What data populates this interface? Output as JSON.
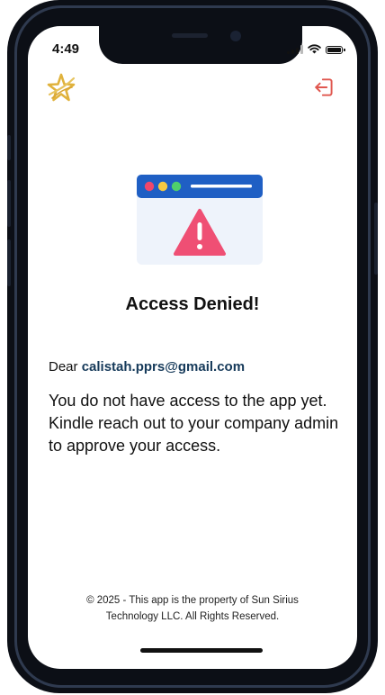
{
  "status_bar": {
    "time": "4:49"
  },
  "header": {
    "logo_icon": "star-logo-icon",
    "logout_icon": "logout-icon"
  },
  "illustration": {
    "icon": "browser-warning-icon",
    "window_bar_color": "#1f5fc4",
    "dot_colors": [
      "#f0476b",
      "#f7c942",
      "#4fd06c"
    ],
    "warning_color": "#ef4f74"
  },
  "main": {
    "title": "Access Denied!",
    "greeting_prefix": "Dear",
    "email": "calistah.pprs@gmail.com",
    "message": "You do not have access to the app yet. Kindle reach out to your company admin to approve your access."
  },
  "footer": {
    "line1": "© 2025 - This app is the property of Sun Sirius",
    "line2": "Technology LLC. All Rights Reserved."
  },
  "colors": {
    "accent_logout": "#e0574f",
    "logo_gold": "#e0b23c",
    "email_color": "#163a5a"
  }
}
